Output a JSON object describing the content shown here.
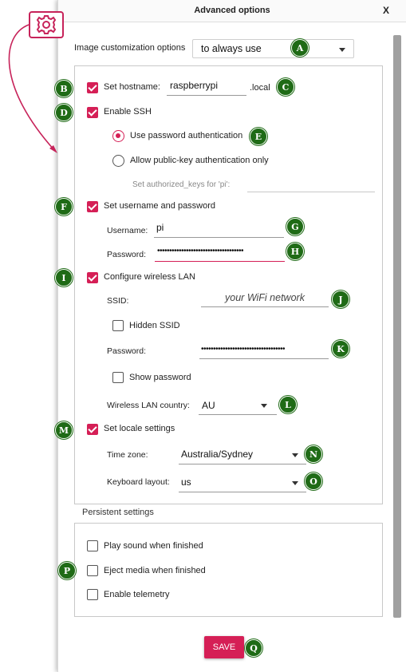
{
  "window": {
    "title": "Advanced options",
    "close_label": "X"
  },
  "image_customization": {
    "label": "Image customization options",
    "value": "to always use"
  },
  "hostname": {
    "label": "Set hostname:",
    "value": "raspberrypi",
    "suffix": ".local"
  },
  "ssh": {
    "label": "Enable SSH",
    "password_auth_label": "Use password authentication",
    "pubkey_label": "Allow public-key authentication only",
    "authorized_keys_label": "Set authorized_keys for 'pi':"
  },
  "user": {
    "label": "Set username and password",
    "username_label": "Username:",
    "username_value": "pi",
    "password_label": "Password:",
    "password_value": "••••••••••••••••••••••••••••••••••••"
  },
  "wlan": {
    "label": "Configure wireless LAN",
    "ssid_label": "SSID:",
    "ssid_value": "your WiFi network",
    "hidden_ssid_label": "Hidden SSID",
    "password_label": "Password:",
    "password_value": "•••••••••••••••••••••••••••••••••••",
    "show_password_label": "Show password",
    "country_label": "Wireless LAN country:",
    "country_value": "AU"
  },
  "locale": {
    "label": "Set locale settings",
    "timezone_label": "Time zone:",
    "timezone_value": "Australia/Sydney",
    "keyboard_label": "Keyboard layout:",
    "keyboard_value": "us"
  },
  "persistent": {
    "label": "Persistent settings",
    "play_sound_label": "Play sound when finished",
    "eject_media_label": "Eject media when finished",
    "telemetry_label": "Enable telemetry"
  },
  "save_label": "SAVE",
  "badges": {
    "A": "A",
    "B": "B",
    "C": "C",
    "D": "D",
    "E": "E",
    "F": "F",
    "G": "G",
    "H": "H",
    "I": "I",
    "J": "J",
    "K": "K",
    "L": "L",
    "M": "M",
    "N": "N",
    "O": "O",
    "P": "P",
    "Q": "Q"
  },
  "colors": {
    "accent": "#d51f56",
    "badge": "#1f6b16",
    "arrow": "#c7235a"
  },
  "icons": {
    "gear": "gear-icon",
    "dropdown": "chevron-down-icon"
  }
}
